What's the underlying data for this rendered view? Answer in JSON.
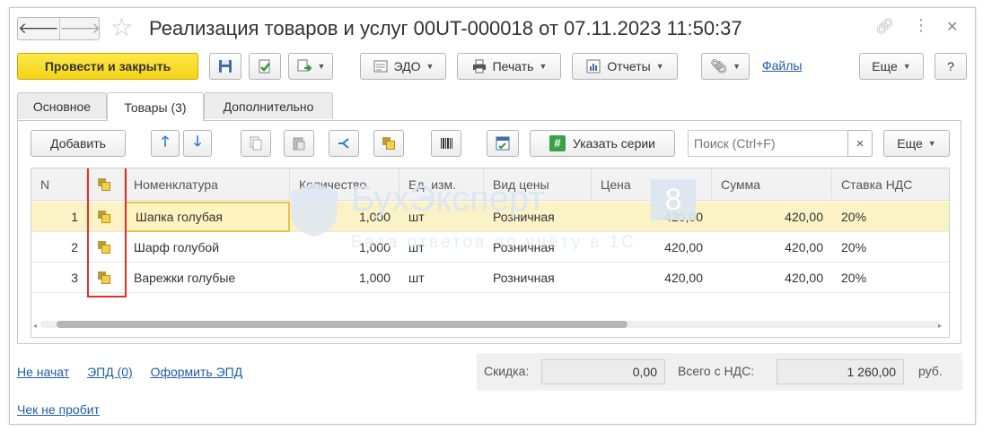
{
  "window": {
    "title": "Реализация товаров и услуг 00UT-000018 от 07.11.2023 11:50:37",
    "back_glyph": "🡐",
    "forward_glyph": "🡒",
    "icons": [
      "star-icon",
      "link-icon",
      "more-dots-icon",
      "close-icon"
    ]
  },
  "toolbar": {
    "post_close": "Провести и закрыть",
    "edo": "ЭДО",
    "print": "Печать",
    "reports": "Отчеты",
    "files": "Файлы",
    "more": "Еще",
    "help": "?"
  },
  "tabs": [
    {
      "label": "Основное",
      "active": false
    },
    {
      "label": "Товары (3)",
      "active": true
    },
    {
      "label": "Дополнительно",
      "active": false
    }
  ],
  "goods_toolbar": {
    "add": "Добавить",
    "specify_series": "Указать серии",
    "search_placeholder": "Поиск (Ctrl+F)",
    "clear": "×",
    "more": "Еще"
  },
  "table": {
    "columns": [
      "N",
      "",
      "Номенклатура",
      "Количество",
      "Ед. изм.",
      "Вид цены",
      "Цена",
      "Сумма",
      "Ставка НДС"
    ],
    "rows": [
      {
        "n": "1",
        "name": "Шапка голубая",
        "qty": "1,000",
        "unit": "шт",
        "price_type": "Розничная",
        "price": "420,00",
        "sum": "420,00",
        "vat": "20%"
      },
      {
        "n": "2",
        "name": "Шарф голубой",
        "qty": "1,000",
        "unit": "шт",
        "price_type": "Розничная",
        "price": "420,00",
        "sum": "420,00",
        "vat": "20%"
      },
      {
        "n": "3",
        "name": "Варежки голубые",
        "qty": "1,000",
        "unit": "шт",
        "price_type": "Розничная",
        "price": "420,00",
        "sum": "420,00",
        "vat": "20%"
      }
    ],
    "selected_row": 1,
    "highlight_color": "#e0302a"
  },
  "watermark": {
    "title": "БухЭксперт",
    "digit": "8",
    "subtitle": "База ответов по учёту в 1С"
  },
  "footer": {
    "status": "Не начат",
    "epd": "ЭПД (0)",
    "make_epd": "Оформить ЭПД",
    "discount_label": "Скидка:",
    "discount": "0,00",
    "total_label": "Всего с НДС:",
    "total": "1 260,00",
    "currency": "руб.",
    "receipt": "Чек не пробит"
  }
}
